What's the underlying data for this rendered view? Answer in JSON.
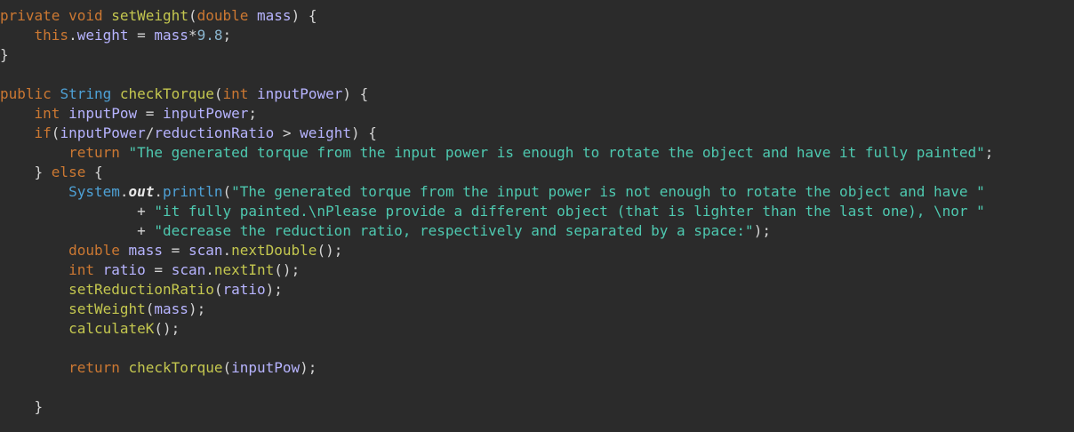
{
  "lines": [
    [
      {
        "t": "private",
        "c": "kw"
      },
      {
        "t": " ",
        "c": "pl"
      },
      {
        "t": "void",
        "c": "kw"
      },
      {
        "t": " ",
        "c": "pl"
      },
      {
        "t": "setWeight",
        "c": "fn"
      },
      {
        "t": "(",
        "c": "pl"
      },
      {
        "t": "double",
        "c": "kw"
      },
      {
        "t": " ",
        "c": "pl"
      },
      {
        "t": "mass",
        "c": "var"
      },
      {
        "t": ") {",
        "c": "pl"
      }
    ],
    [
      {
        "t": "    ",
        "c": "pl"
      },
      {
        "t": "this",
        "c": "kw"
      },
      {
        "t": ".",
        "c": "pl"
      },
      {
        "t": "weight",
        "c": "var"
      },
      {
        "t": " = ",
        "c": "pl"
      },
      {
        "t": "mass",
        "c": "var"
      },
      {
        "t": "*",
        "c": "pl"
      },
      {
        "t": "9.8",
        "c": "num"
      },
      {
        "t": ";",
        "c": "pl"
      }
    ],
    [
      {
        "t": "}",
        "c": "pl"
      }
    ],
    [],
    [
      {
        "t": "public",
        "c": "kw"
      },
      {
        "t": " ",
        "c": "pl"
      },
      {
        "t": "String",
        "c": "ty"
      },
      {
        "t": " ",
        "c": "pl"
      },
      {
        "t": "checkTorque",
        "c": "fn"
      },
      {
        "t": "(",
        "c": "pl"
      },
      {
        "t": "int",
        "c": "kw"
      },
      {
        "t": " ",
        "c": "pl"
      },
      {
        "t": "inputPower",
        "c": "var"
      },
      {
        "t": ") {",
        "c": "pl"
      }
    ],
    [
      {
        "t": "    ",
        "c": "pl"
      },
      {
        "t": "int",
        "c": "kw"
      },
      {
        "t": " ",
        "c": "pl"
      },
      {
        "t": "inputPow",
        "c": "var"
      },
      {
        "t": " = ",
        "c": "pl"
      },
      {
        "t": "inputPower",
        "c": "var"
      },
      {
        "t": ";",
        "c": "pl"
      }
    ],
    [
      {
        "t": "    ",
        "c": "pl"
      },
      {
        "t": "if",
        "c": "kw"
      },
      {
        "t": "(",
        "c": "pl"
      },
      {
        "t": "inputPower",
        "c": "var"
      },
      {
        "t": "/",
        "c": "pl"
      },
      {
        "t": "reductionRatio",
        "c": "var"
      },
      {
        "t": " > ",
        "c": "pl"
      },
      {
        "t": "weight",
        "c": "var"
      },
      {
        "t": ") {",
        "c": "pl"
      }
    ],
    [
      {
        "t": "        ",
        "c": "pl"
      },
      {
        "t": "return",
        "c": "kw"
      },
      {
        "t": " ",
        "c": "pl"
      },
      {
        "t": "\"The generated torque from the input power is enough to rotate the object and have it fully painted\"",
        "c": "str"
      },
      {
        "t": ";",
        "c": "pl"
      }
    ],
    [
      {
        "t": "    ",
        "c": "pl"
      },
      {
        "t": "} ",
        "c": "pl"
      },
      {
        "t": "else",
        "c": "kw"
      },
      {
        "t": " {",
        "c": "pl"
      }
    ],
    [
      {
        "t": "        ",
        "c": "pl"
      },
      {
        "t": "System",
        "c": "ty"
      },
      {
        "t": ".",
        "c": "pl"
      },
      {
        "t": "out",
        "c": "out"
      },
      {
        "t": ".",
        "c": "pl"
      },
      {
        "t": "println",
        "c": "ty"
      },
      {
        "t": "(",
        "c": "pl"
      },
      {
        "t": "\"The generated torque from the input power is not enough to rotate the object and have \"",
        "c": "str"
      }
    ],
    [
      {
        "t": "                ",
        "c": "pl"
      },
      {
        "t": "+ ",
        "c": "pl"
      },
      {
        "t": "\"it fully painted.\\nPlease provide a different object (that is lighter than the last one), \\nor \"",
        "c": "str"
      }
    ],
    [
      {
        "t": "                ",
        "c": "pl"
      },
      {
        "t": "+ ",
        "c": "pl"
      },
      {
        "t": "\"decrease the reduction ratio, respectively and separated by a space:\"",
        "c": "str"
      },
      {
        "t": ");",
        "c": "pl"
      }
    ],
    [
      {
        "t": "        ",
        "c": "pl"
      },
      {
        "t": "double",
        "c": "kw"
      },
      {
        "t": " ",
        "c": "pl"
      },
      {
        "t": "mass",
        "c": "var"
      },
      {
        "t": " = ",
        "c": "pl"
      },
      {
        "t": "scan",
        "c": "var"
      },
      {
        "t": ".",
        "c": "pl"
      },
      {
        "t": "nextDouble",
        "c": "fn"
      },
      {
        "t": "();",
        "c": "pl"
      }
    ],
    [
      {
        "t": "        ",
        "c": "pl"
      },
      {
        "t": "int",
        "c": "kw"
      },
      {
        "t": " ",
        "c": "pl"
      },
      {
        "t": "ratio",
        "c": "var"
      },
      {
        "t": " = ",
        "c": "pl"
      },
      {
        "t": "scan",
        "c": "var"
      },
      {
        "t": ".",
        "c": "pl"
      },
      {
        "t": "nextInt",
        "c": "fn"
      },
      {
        "t": "();",
        "c": "pl"
      }
    ],
    [
      {
        "t": "        ",
        "c": "pl"
      },
      {
        "t": "setReductionRatio",
        "c": "fn"
      },
      {
        "t": "(",
        "c": "pl"
      },
      {
        "t": "ratio",
        "c": "var"
      },
      {
        "t": ");",
        "c": "pl"
      }
    ],
    [
      {
        "t": "        ",
        "c": "pl"
      },
      {
        "t": "setWeight",
        "c": "fn"
      },
      {
        "t": "(",
        "c": "pl"
      },
      {
        "t": "mass",
        "c": "var"
      },
      {
        "t": ");",
        "c": "pl"
      }
    ],
    [
      {
        "t": "        ",
        "c": "pl"
      },
      {
        "t": "calculateK",
        "c": "fn"
      },
      {
        "t": "();",
        "c": "pl"
      }
    ],
    [],
    [
      {
        "t": "        ",
        "c": "pl"
      },
      {
        "t": "return",
        "c": "kw"
      },
      {
        "t": " ",
        "c": "pl"
      },
      {
        "t": "checkTorque",
        "c": "fn"
      },
      {
        "t": "(",
        "c": "pl"
      },
      {
        "t": "inputPow",
        "c": "var"
      },
      {
        "t": ");",
        "c": "pl"
      }
    ],
    [],
    [
      {
        "t": "    ",
        "c": "pl"
      },
      {
        "t": "}",
        "c": "pl"
      }
    ]
  ],
  "colors": {
    "background": "#2b2b2b",
    "keyword": "#cc7832",
    "function": "#c4c74f",
    "type": "#4ea1d6",
    "variable": "#b7b4ff",
    "plain": "#d4d4d4",
    "string": "#4ec9b0",
    "number": "#8bb6cf"
  }
}
